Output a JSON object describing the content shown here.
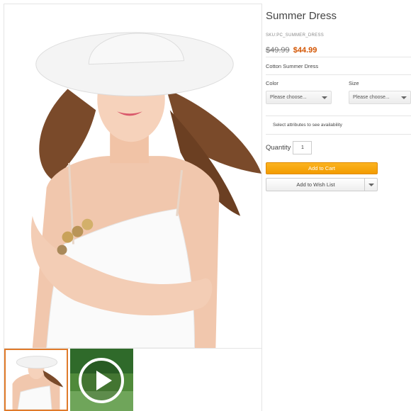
{
  "product": {
    "title": "Summer Dress",
    "sku": "SKU:PC_SUMMER_DRESS",
    "price_old": "$49.99",
    "price_new": "$44.99",
    "short_description": "Cotton Summer Dress"
  },
  "attributes": {
    "color_label": "Color",
    "color_value": "Please choose...",
    "size_label": "Size",
    "size_value": "Please choose...",
    "availability_note": "Select attributes to see availability"
  },
  "purchase": {
    "quantity_label": "Quantity",
    "quantity_value": "1",
    "add_to_cart_label": "Add to Cart",
    "wish_list_label": "Add to Wish List"
  },
  "media": {
    "main_image_icon": "product-photo-woman-in-hat",
    "thumbnails": [
      {
        "type": "photo",
        "icon": "product-photo-thumbnail",
        "selected": true
      },
      {
        "type": "video",
        "icon": "play-icon",
        "selected": false
      }
    ]
  },
  "colors": {
    "accent": "#f39c00",
    "sale_price": "#d35400",
    "thumb_border": "#e07a2a"
  }
}
